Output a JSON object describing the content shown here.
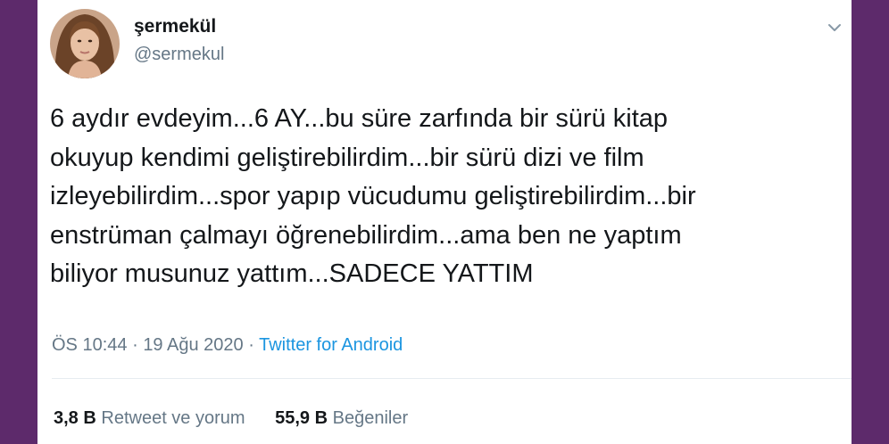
{
  "user": {
    "name": "şermekül",
    "handle": "@sermekul"
  },
  "tweet": {
    "lines": [
      "6 aydır evdeyim...6 AY...bu süre zarfında bir sürü kitap",
      "okuyup kendimi geliştirebilirdim...bir sürü dizi ve film",
      "izleyebilirdim...spor yapıp vücudumu geliştirebilirdim...bir",
      "enstrüman çalmayı öğrenebilirdim...ama ben ne yaptım",
      "biliyor musunuz yattım...SADECE YATTIM"
    ]
  },
  "meta": {
    "time": "ÖS 10:44",
    "separator": "·",
    "date": "19 Ağu 2020",
    "source": "Twitter for Android"
  },
  "stats": {
    "retweets_count": "3,8 B",
    "retweets_label": "Retweet ve yorum",
    "likes_count": "55,9 B",
    "likes_label": "Beğeniler"
  },
  "colors": {
    "frame": "#5d2a6b",
    "link": "#1b95e0",
    "secondary_text": "#657786",
    "primary_text": "#14171a"
  }
}
